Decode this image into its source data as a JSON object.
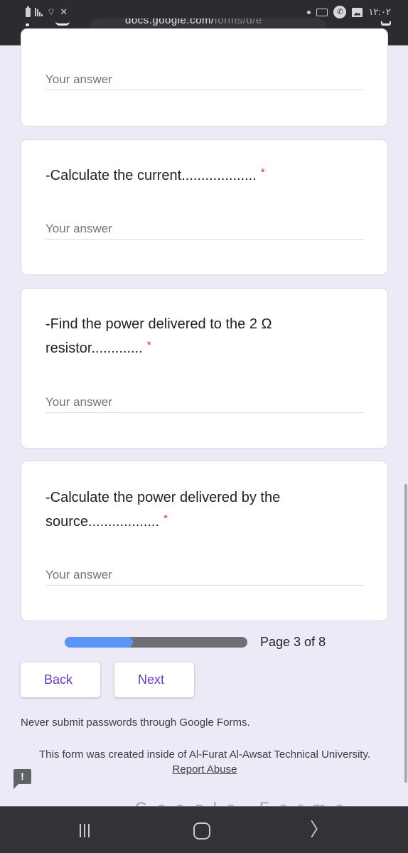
{
  "status_bar": {
    "time": "١٢:٠٢",
    "left_icons": [
      "battery-icon",
      "signal-icon",
      "wifi-icon",
      "mute-icon"
    ],
    "right_icons": [
      "notification-dot-icon",
      "video-call-icon",
      "phone-call-icon",
      "gallery-icon"
    ]
  },
  "browser": {
    "url_visible": "docs.google.com/",
    "url_dim": "forms/d/e"
  },
  "form": {
    "prev_card": {
      "placeholder": "Your answer"
    },
    "questions": [
      {
        "title": "-Calculate the current...................",
        "required_mark": "*",
        "placeholder": "Your answer",
        "value": ""
      },
      {
        "title": "-Find the power delivered to the 2 Ω resistor.............",
        "required_mark": "*",
        "placeholder": "Your answer",
        "value": ""
      },
      {
        "title": "-Calculate the power delivered by the source..................",
        "required_mark": "*",
        "placeholder": "Your answer",
        "value": ""
      }
    ],
    "progress": {
      "current_page": 3,
      "total_pages": 8,
      "fraction": 0.375,
      "label": "Page 3 of 8"
    },
    "buttons": {
      "back": "Back",
      "next": "Next"
    },
    "footer": {
      "warning": "Never submit passwords through Google Forms.",
      "created_text": "This form was created inside of Al-Furat Al-Awsat Technical University.",
      "report_link": "Report Abuse",
      "feedback_icon": "!",
      "brand_peek": "Google Forms"
    },
    "colors": {
      "accent": "#673ab7",
      "progress_fill": "#5a95f5",
      "progress_track": "#6d6f74",
      "background": "#ede9f7",
      "required": "#d93025"
    }
  },
  "navbar": {
    "buttons": [
      "recents-icon",
      "home-icon",
      "back-icon"
    ],
    "back_glyph": "〉"
  }
}
